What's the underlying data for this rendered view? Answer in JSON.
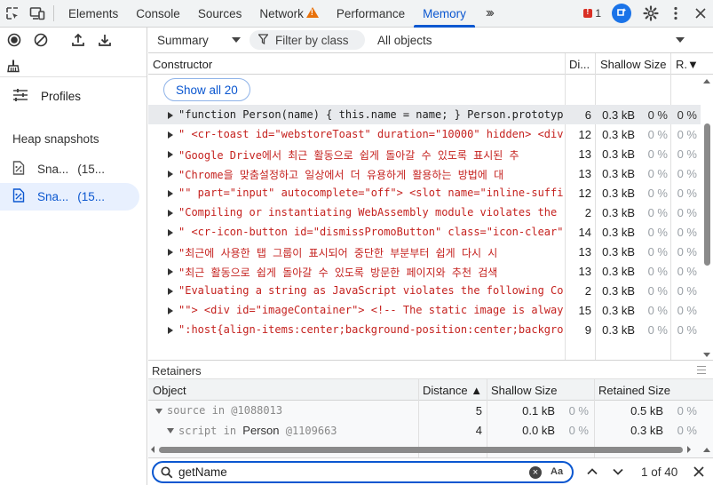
{
  "tabs": [
    {
      "label": "Elements",
      "active": false
    },
    {
      "label": "Console",
      "active": false
    },
    {
      "label": "Sources",
      "active": false
    },
    {
      "label": "Network",
      "active": false,
      "warning": true
    },
    {
      "label": "Performance",
      "active": false
    },
    {
      "label": "Memory",
      "active": true
    }
  ],
  "errors": {
    "count": "1"
  },
  "sidebar": {
    "profiles_label": "Profiles",
    "heap_title": "Heap snapshots",
    "snapshots": [
      {
        "name": "Sna...",
        "count": "(15...",
        "selected": false
      },
      {
        "name": "Sna...",
        "count": "(15...",
        "selected": true
      }
    ]
  },
  "toolbar": {
    "view": "Summary",
    "filter_placeholder": "Filter by class",
    "scope": "All objects"
  },
  "grid": {
    "headers": {
      "constructor": "Constructor",
      "distance": "Di...",
      "shallow": "Shallow Size",
      "retained": "R.▼"
    },
    "show_all": "Show all 20",
    "rows": [
      {
        "name": "\"function Person(name) { this.name = name; } Person.prototype.",
        "dist": "6",
        "size": "0.3 kB",
        "pct": "0 %",
        "r": "0 %",
        "highlight": true
      },
      {
        "name": "\" <cr-toast id=\"webstoreToast\" duration=\"10000\" hidden> <div>C",
        "dist": "12",
        "size": "0.3 kB",
        "pct": "0 %",
        "r": "0 %"
      },
      {
        "name": "\"Google Drive에서 최근 활동으로 쉽게 돌아갈 수 있도록 표시된 추",
        "dist": "13",
        "size": "0.3 kB",
        "pct": "0 %",
        "r": "0 %"
      },
      {
        "name": "\"Chrome을 맞춤설정하고 일상에서 더 유용하게 활용하는 방법에 대",
        "dist": "13",
        "size": "0.3 kB",
        "pct": "0 %",
        "r": "0 %"
      },
      {
        "name": "\"\" part=\"input\" autocomplete=\"off\"> <slot name=\"inline-suffix\"",
        "dist": "12",
        "size": "0.3 kB",
        "pct": "0 %",
        "r": "0 %"
      },
      {
        "name": "\"Compiling or instantiating WebAssembly module violates the fo",
        "dist": "2",
        "size": "0.3 kB",
        "pct": "0 %",
        "r": "0 %"
      },
      {
        "name": "\" <cr-icon-button id=\"dismissPromoButton\" class=\"icon-clear\" a",
        "dist": "14",
        "size": "0.3 kB",
        "pct": "0 %",
        "r": "0 %"
      },
      {
        "name": "\"최근에 사용한 탭 그룹이 표시되어 중단한 부분부터 쉽게 다시 시",
        "dist": "13",
        "size": "0.3 kB",
        "pct": "0 %",
        "r": "0 %"
      },
      {
        "name": "\"최근 활동으로 쉽게 돌아갈 수 있도록 방문한 페이지와 추천 검색",
        "dist": "13",
        "size": "0.3 kB",
        "pct": "0 %",
        "r": "0 %"
      },
      {
        "name": "\"Evaluating a string as JavaScript violates the following Cont",
        "dist": "2",
        "size": "0.3 kB",
        "pct": "0 %",
        "r": "0 %"
      },
      {
        "name": "\"\"> <div id=\"imageContainer\"> <!-- The static image is always",
        "dist": "15",
        "size": "0.3 kB",
        "pct": "0 %",
        "r": "0 %"
      },
      {
        "name": "\":host{align-items:center;background-position:center;backgroun",
        "dist": "9",
        "size": "0.3 kB",
        "pct": "0 %",
        "r": "0 %"
      }
    ]
  },
  "retainers": {
    "title": "Retainers",
    "headers": {
      "object": "Object",
      "distance": "Distance ▲",
      "shallow": "Shallow Size",
      "retained": "Retained Size"
    },
    "rows": [
      {
        "prop": "source",
        "in": "in",
        "cls": "",
        "id": "@1088013",
        "dist": "5",
        "size": "0.1 kB",
        "pct": "0 %",
        "rsize": "0.5 kB",
        "rpct": "0 %"
      },
      {
        "prop": "script",
        "in": "in",
        "cls": "Person",
        "id": "@1109663",
        "dist": "4",
        "size": "0.0 kB",
        "pct": "0 %",
        "rsize": "0.3 kB",
        "rpct": "0 %"
      }
    ]
  },
  "search": {
    "value": "getName",
    "case_label": "Aa",
    "match": "1 of 40"
  },
  "colors": {
    "accent": "#0b57d0",
    "string": "#c5221f",
    "warning": "#e8710a",
    "error": "#d93025"
  }
}
